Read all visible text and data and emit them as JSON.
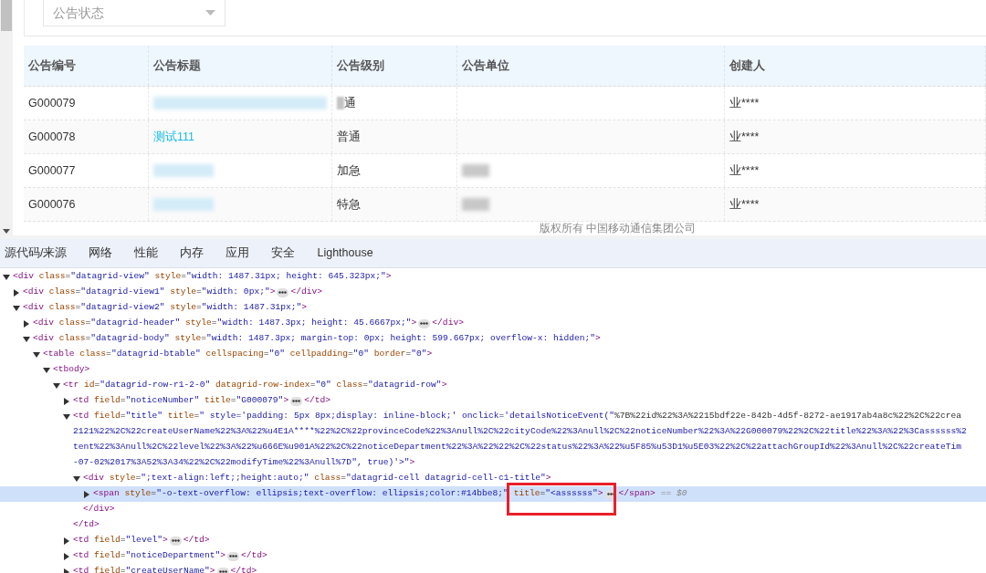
{
  "page": {
    "status_filter": {
      "placeholder": "公告状态"
    },
    "table": {
      "columns": [
        "公告编号",
        "公告标题",
        "公告级别",
        "公告单位",
        "创建人"
      ],
      "rows": [
        {
          "cells": [
            {
              "kind": "text",
              "text": "G000079"
            },
            {
              "kind": "blurred-long-link"
            },
            {
              "kind": "partly-blurred",
              "text": "通"
            },
            {
              "kind": "empty"
            },
            {
              "kind": "text",
              "text": "业****"
            }
          ]
        },
        {
          "cells": [
            {
              "kind": "text",
              "text": "G000078"
            },
            {
              "kind": "link",
              "text": "测试111"
            },
            {
              "kind": "text",
              "text": "普通"
            },
            {
              "kind": "empty"
            },
            {
              "kind": "text",
              "text": "业****"
            }
          ]
        },
        {
          "cells": [
            {
              "kind": "text",
              "text": "G000077"
            },
            {
              "kind": "blurred-link"
            },
            {
              "kind": "text",
              "text": "加急"
            },
            {
              "kind": "blurred"
            },
            {
              "kind": "text",
              "text": "业****"
            }
          ]
        },
        {
          "cells": [
            {
              "kind": "text",
              "text": "G000076"
            },
            {
              "kind": "blurred-link"
            },
            {
              "kind": "text",
              "text": "特急"
            },
            {
              "kind": "blurred"
            },
            {
              "kind": "text",
              "text": "业****"
            }
          ]
        }
      ]
    },
    "footer": "版权所有 中国移动通信集团公司"
  },
  "devtools": {
    "tabs": [
      "源代码/来源",
      "网络",
      "性能",
      "内存",
      "应用",
      "安全",
      "Lighthouse"
    ],
    "elements": [
      {
        "lines": [
          "<div class=\"datagrid-view\" style=\"width: 1487.31px; height: 645.323px;\">"
        ],
        "expanded": true,
        "selected": false,
        "children": [
          {
            "lines": [
              "<div class=\"datagrid-view1\" style=\"width: 0px;\">"
            ],
            "expanded": false,
            "selected": false,
            "close": "</div>"
          },
          {
            "lines": [
              "<div class=\"datagrid-view2\" style=\"width: 1487.31px;\">"
            ],
            "expanded": true,
            "selected": false,
            "children": [
              {
                "lines": [
                  "<div class=\"datagrid-header\" style=\"width: 1487.3px; height: 45.6667px;\">"
                ],
                "expanded": false,
                "selected": false,
                "close": "</div>"
              },
              {
                "lines": [
                  "<div class=\"datagrid-body\" style=\"width: 1487.3px; margin-top: 0px; height: 599.667px; overflow-x: hidden;\">"
                ],
                "expanded": true,
                "selected": false,
                "children": [
                  {
                    "lines": [
                      "<table class=\"datagrid-btable\" cellspacing=\"0\" cellpadding=\"0\" border=\"0\">"
                    ],
                    "expanded": true,
                    "selected": false,
                    "children": [
                      {
                        "lines": [
                          "<tbody>"
                        ],
                        "expanded": true,
                        "selected": false,
                        "children": [
                          {
                            "lines": [
                              "<tr id=\"datagrid-row-r1-2-0\" datagrid-row-index=\"0\" class=\"datagrid-row\">"
                            ],
                            "expanded": true,
                            "selected": false,
                            "children": [
                              {
                                "lines": [
                                  "<td field=\"noticeNumber\" title=\"G000079\">"
                                ],
                                "expanded": false,
                                "selected": false,
                                "close": "</td>"
                              },
                              {
                                "lines": [
                                  "<td field=\"title\" title=\" style='padding: 5px 8px;display: inline-block;' onclick='detailsNoticeEvent(\"%7B%22id%22%3A%2215bdf22e-842b-4d5f-8272-ae1917ab4a8c%22%2C%22crea",
                                  "2121%22%2C%22createUserName%22%3A%22%u4E1A****%22%2C%22provinceCode%22%3Anull%2C%22cityCode%22%3Anull%2C%22noticeNumber%22%3A%22G000079%22%2C%22title%22%3A%22%3Cassssss%2",
                                  "tent%22%3Anull%2C%22level%22%3A%22%u666E%u901A%22%2C%22noticeDepartment%22%3A%22%22%2C%22status%22%3A%22%u5F85%u53D1%u5E03%22%2C%22attachGroupId%22%3Anull%2C%22createTim",
                                  "-07-02%2017%3A52%3A34%22%2C%22modifyTime%22%3Anull%7D\", true)'>\">"
                                ],
                                "expanded": true,
                                "selected": false,
                                "close": "</td>",
                                "children": [
                                  {
                                    "lines": [
                                      "<div style=\";text-align:left;;height:auto;\" class=\"datagrid-cell datagrid-cell-c1-title\">"
                                    ],
                                    "expanded": true,
                                    "selected": false,
                                    "close": "</div>",
                                    "children": [
                                      {
                                        "lines": [
                                          "<span style=\"-o-text-overflow: ellipsis;text-overflow: ellipsis;color:#14bbe8;\" title=\"<assssss\">"
                                        ],
                                        "expanded": false,
                                        "selected": true,
                                        "close": "</span>",
                                        "suffix": "== $0"
                                      }
                                    ]
                                  }
                                ]
                              },
                              {
                                "lines": [
                                  "<td field=\"level\">"
                                ],
                                "expanded": false,
                                "selected": false,
                                "close": "</td>"
                              },
                              {
                                "lines": [
                                  "<td field=\"noticeDepartment\">"
                                ],
                                "expanded": false,
                                "selected": false,
                                "close": "</td>"
                              },
                              {
                                "lines": [
                                  "<td field=\"createUserName\">"
                                ],
                                "expanded": false,
                                "selected": false,
                                "close": "</td>"
                              }
                            ]
                          }
                        ]
                      }
                    ]
                  }
                ]
              }
            ]
          }
        ]
      }
    ]
  }
}
